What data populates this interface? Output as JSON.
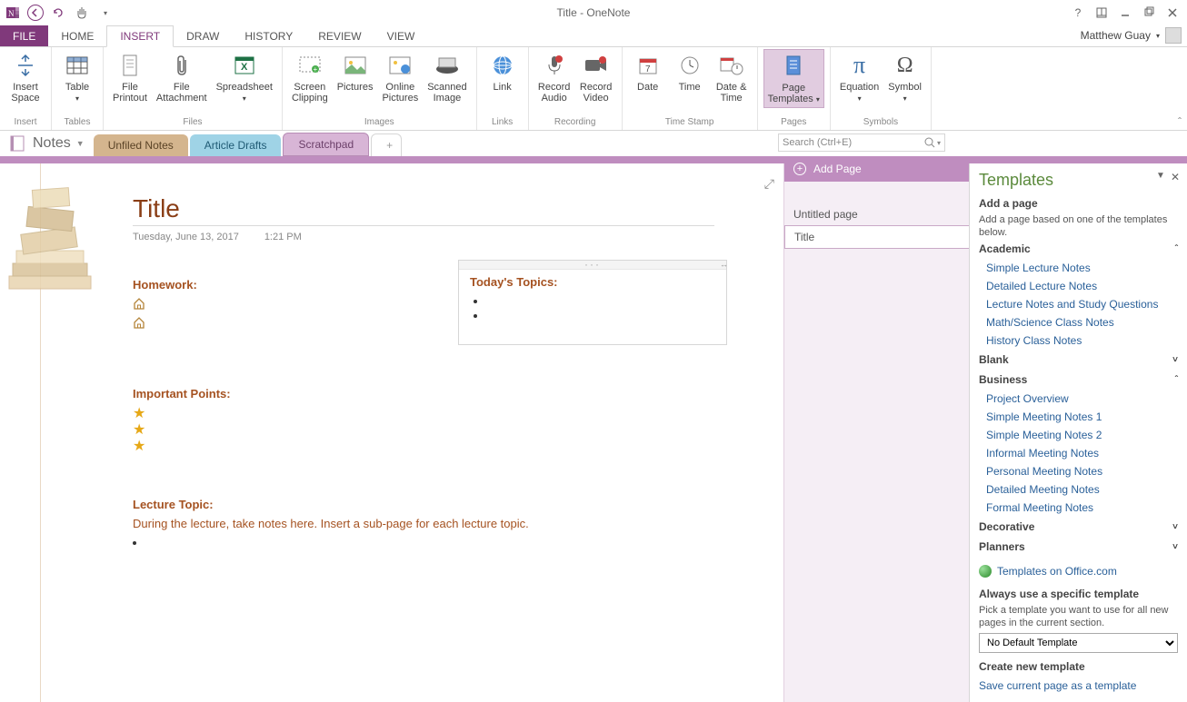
{
  "titlebar": {
    "title": "Title - OneNote"
  },
  "user": {
    "name": "Matthew Guay"
  },
  "ribbon_tabs": {
    "file": "FILE",
    "home": "HOME",
    "insert": "INSERT",
    "draw": "DRAW",
    "history": "HISTORY",
    "review": "REVIEW",
    "view": "VIEW"
  },
  "ribbon": {
    "insert_space": "Insert\nSpace",
    "table": "Table",
    "file_printout": "File\nPrintout",
    "file_attachment": "File\nAttachment",
    "spreadsheet": "Spreadsheet",
    "screen_clipping": "Screen\nClipping",
    "pictures": "Pictures",
    "online_pictures": "Online\nPictures",
    "scanned_image": "Scanned\nImage",
    "link": "Link",
    "record_audio": "Record\nAudio",
    "record_video": "Record\nVideo",
    "date": "Date",
    "time": "Time",
    "date_time": "Date &\nTime",
    "page_templates": "Page\nTemplates",
    "equation": "Equation",
    "symbol": "Symbol",
    "g_insert": "Insert",
    "g_tables": "Tables",
    "g_files": "Files",
    "g_images": "Images",
    "g_links": "Links",
    "g_recording": "Recording",
    "g_timestamp": "Time Stamp",
    "g_pages": "Pages",
    "g_symbols": "Symbols"
  },
  "notebook": {
    "name": "Notes",
    "tabs": {
      "unfiled": "Unfiled Notes",
      "drafts": "Article Drafts",
      "scratch": "Scratchpad"
    }
  },
  "search": {
    "placeholder": "Search (Ctrl+E)"
  },
  "pagelist": {
    "add": "Add Page",
    "items": [
      "Untitled page",
      "Title"
    ],
    "selected": 1
  },
  "page": {
    "title": "Title",
    "date": "Tuesday, June 13, 2017",
    "time": "1:21 PM",
    "homework_h": "Homework:",
    "important_h": "Important Points:",
    "lecture_h": "Lecture Topic:",
    "lecture_text": "During the lecture, take notes here.  Insert a sub-page for each lecture topic.",
    "topics_h": "Today's Topics:"
  },
  "templates": {
    "title": "Templates",
    "add_h": "Add a page",
    "add_desc": "Add a page based on one of the templates below.",
    "cat_academic": "Academic",
    "academic": [
      "Simple Lecture Notes",
      "Detailed Lecture Notes",
      "Lecture Notes and Study Questions",
      "Math/Science Class Notes",
      "History Class Notes"
    ],
    "cat_blank": "Blank",
    "cat_business": "Business",
    "business": [
      "Project Overview",
      "Simple Meeting Notes 1",
      "Simple Meeting Notes 2",
      "Informal Meeting Notes",
      "Personal Meeting Notes",
      "Detailed Meeting Notes",
      "Formal Meeting Notes"
    ],
    "cat_decorative": "Decorative",
    "cat_planners": "Planners",
    "office_link": "Templates on Office.com",
    "always_h": "Always use a specific template",
    "always_desc": "Pick a template you want to use for all new pages in the current section.",
    "select_default": "No Default Template",
    "create_h": "Create new template",
    "save_link": "Save current page as a template"
  }
}
